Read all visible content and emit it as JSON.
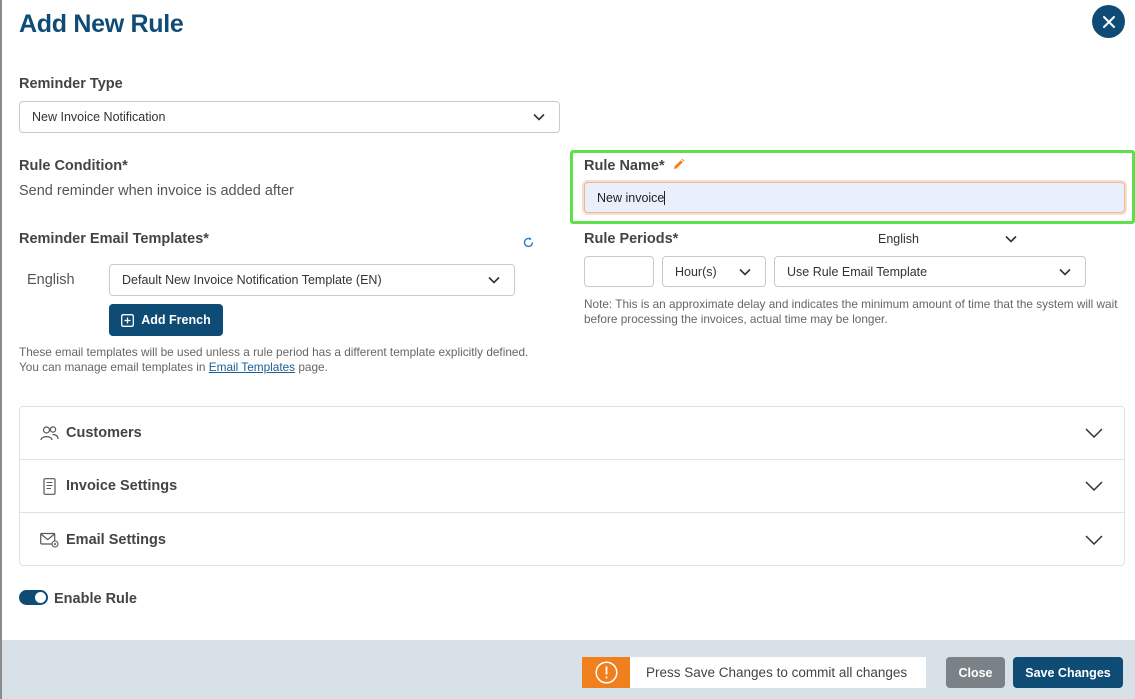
{
  "header": {
    "title": "Add New Rule",
    "close_icon": "close-x-icon"
  },
  "reminder_type": {
    "label": "Reminder Type",
    "value": "New Invoice Notification"
  },
  "rule_condition": {
    "label": "Rule Condition*",
    "text": "Send reminder when invoice is added after"
  },
  "rule_name": {
    "label": "Rule Name*",
    "value": "New invoice",
    "edit_icon": "pencil-icon"
  },
  "email_templates": {
    "label": "Reminder Email Templates*",
    "refresh_icon": "refresh-icon",
    "language": "English",
    "template_value": "Default New Invoice Notification Template (EN)",
    "add_french_label": "Add French",
    "note_text": "These email templates will be used unless a rule period has a different template explicitly defined. You can manage email templates in ",
    "note_link": "Email Templates",
    "note_suffix": " page."
  },
  "rule_periods": {
    "label": "Rule Periods*",
    "language_value": "English",
    "amount_value": "",
    "unit_value": "Hour(s)",
    "template_value": "Use Rule Email Template",
    "note": "Note: This is an approximate delay and indicates the minimum amount of time that the system will wait before processing the invoices, actual time may be longer."
  },
  "accordion": [
    {
      "label": "Customers",
      "icon": "users-icon"
    },
    {
      "label": "Invoice Settings",
      "icon": "document-icon"
    },
    {
      "label": "Email Settings",
      "icon": "email-settings-icon"
    }
  ],
  "enable_rule": {
    "label": "Enable Rule",
    "enabled": true
  },
  "footer": {
    "notice_icon": "info-icon",
    "notice_text": "Press Save Changes to commit all changes",
    "close_label": "Close",
    "save_label": "Save Changes"
  },
  "colors": {
    "primary": "#0f4c75",
    "highlight": "#5ee04b",
    "warning": "#f07f1d",
    "footer_bg": "#d8e1e8"
  }
}
